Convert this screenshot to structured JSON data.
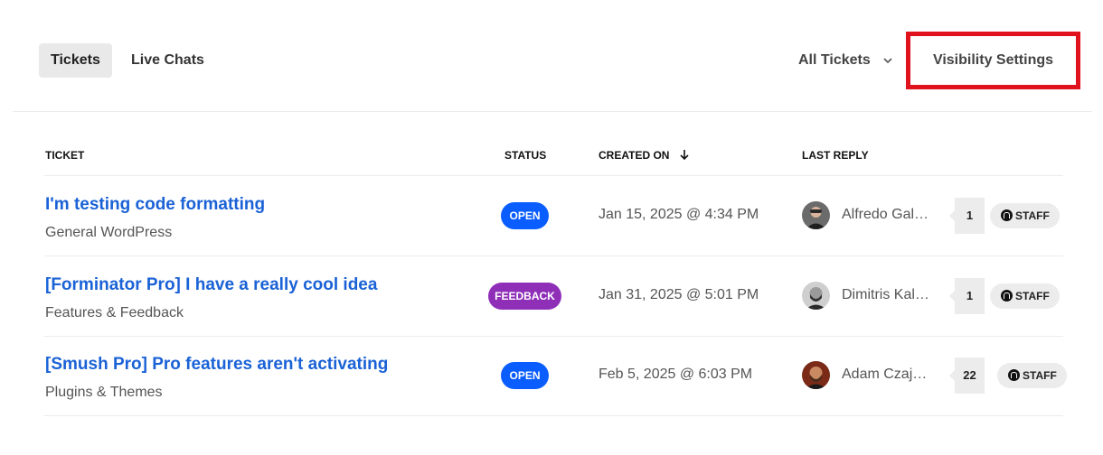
{
  "tabs": [
    {
      "label": "Tickets",
      "active": true
    },
    {
      "label": "Live Chats",
      "active": false
    }
  ],
  "filter": {
    "label": "All Tickets",
    "icon": "chevron-down-icon"
  },
  "visibility_button": {
    "label": "Visibility Settings",
    "highlight_color": "#e0131c"
  },
  "table": {
    "headers": {
      "ticket": "TICKET",
      "status": "STATUS",
      "created_on": "CREATED ON",
      "last_reply": "LAST REPLY"
    },
    "sort_icon": "arrow-down-icon",
    "rows": [
      {
        "title": "I'm testing code formatting",
        "category": "General WordPress",
        "status": "OPEN",
        "status_color": "#0a5dff",
        "created": "Jan 15, 2025 @ 4:34 PM",
        "last_reply": "Alfredo Gal…",
        "reply_count": "1",
        "staff_label": "STAFF"
      },
      {
        "title": "[Forminator Pro] I have a really cool idea",
        "category": "Features & Feedback",
        "status": "FEEDBACK",
        "status_color": "#8f2fb8",
        "created": "Jan 31, 2025 @ 5:01 PM",
        "last_reply": "Dimitris Kal…",
        "reply_count": "1",
        "staff_label": "STAFF"
      },
      {
        "title": "[Smush Pro] Pro features aren't activating",
        "category": "Plugins & Themes",
        "status": "OPEN",
        "status_color": "#0a5dff",
        "created": "Feb 5, 2025 @ 6:03 PM",
        "last_reply": "Adam Czaj…",
        "reply_count": "22",
        "staff_label": "STAFF"
      }
    ]
  },
  "colors": {
    "link": "#1a62d6",
    "open_badge": "#0a5dff",
    "feedback_badge": "#8f2fb8"
  }
}
